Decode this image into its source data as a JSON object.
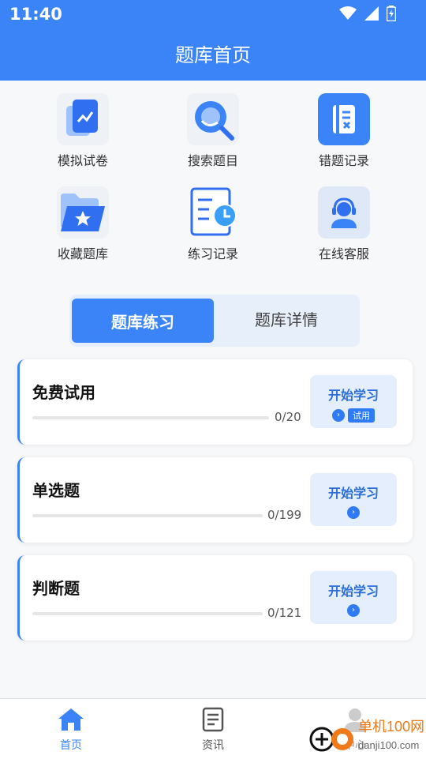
{
  "status": {
    "time": "11:40"
  },
  "header": {
    "title": "题库首页"
  },
  "grid": [
    {
      "label": "模拟试卷",
      "icon": "exam-paper-icon"
    },
    {
      "label": "搜索题目",
      "icon": "search-icon"
    },
    {
      "label": "错题记录",
      "icon": "wrong-record-icon"
    },
    {
      "label": "收藏题库",
      "icon": "favorite-folder-icon"
    },
    {
      "label": "练习记录",
      "icon": "practice-record-icon"
    },
    {
      "label": "在线客服",
      "icon": "customer-service-icon"
    }
  ],
  "segment": {
    "active": "题库练习",
    "inactive": "题库详情"
  },
  "cards": [
    {
      "title": "免费试用",
      "progress": 0,
      "count": "0/20",
      "button": "开始学习",
      "badge": "试用"
    },
    {
      "title": "单选题",
      "progress": 0,
      "count": "0/199",
      "button": "开始学习"
    },
    {
      "title": "判断题",
      "progress": 0,
      "count": "0/121",
      "button": "开始学习"
    }
  ],
  "tabbar": {
    "home": "首页",
    "news": "资讯",
    "profile": "中心"
  },
  "watermark": {
    "brand": "单机100网",
    "url": "danji100.com"
  },
  "colors": {
    "primary": "#3a84f7",
    "accent": "#2f7af5"
  }
}
